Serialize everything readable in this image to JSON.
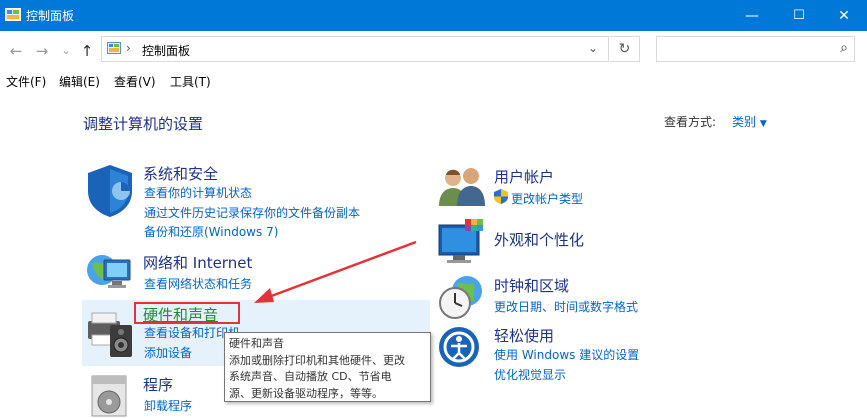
{
  "window": {
    "title": "控制面板",
    "controls": {
      "minimize": "—",
      "maximize": "☐",
      "close": "✕"
    }
  },
  "address": {
    "back": "←",
    "forward": "→",
    "recent": "⌄",
    "up": "↑",
    "separator": "›",
    "path": "控制面板",
    "dropdown": "⌄",
    "refresh": "↻",
    "search_placeholder": "",
    "search_icon": "⌕"
  },
  "menu": [
    "文件(F)",
    "编辑(E)",
    "查看(V)",
    "工具(T)"
  ],
  "page": {
    "title": "调整计算机的设置",
    "view_by_label": "查看方式:",
    "view_by_value": "类别"
  },
  "categories": {
    "system": {
      "title": "系统和安全",
      "links": [
        "查看你的计算机状态",
        "通过文件历史记录保存你的文件备份副本",
        "备份和还原(Windows 7)"
      ]
    },
    "network": {
      "title": "网络和 Internet",
      "links": [
        "查看网络状态和任务"
      ]
    },
    "hardware": {
      "title": "硬件和声音",
      "links": [
        "查看设备和打印机",
        "添加设备"
      ]
    },
    "programs": {
      "title": "程序",
      "links": [
        "卸载程序"
      ]
    },
    "users": {
      "title": "用户帐户",
      "links": [
        "更改帐户类型"
      ]
    },
    "appearance": {
      "title": "外观和个性化",
      "links": []
    },
    "clock": {
      "title": "时钟和区域",
      "links": [
        "更改日期、时间或数字格式"
      ]
    },
    "ease": {
      "title": "轻松使用",
      "links": [
        "使用 Windows 建议的设置",
        "优化视觉显示"
      ]
    }
  },
  "tooltip": {
    "lines": [
      "硬件和声音",
      "添加或删除打印机和其他硬件、更改",
      "系统声音、自动播放 CD、节省电",
      "源、更新设备驱动程序，等等。"
    ]
  },
  "colors": {
    "titlebar": "#0078d7",
    "link": "#0066cc",
    "heading": "#1e3287",
    "annotation": "#e53238"
  }
}
